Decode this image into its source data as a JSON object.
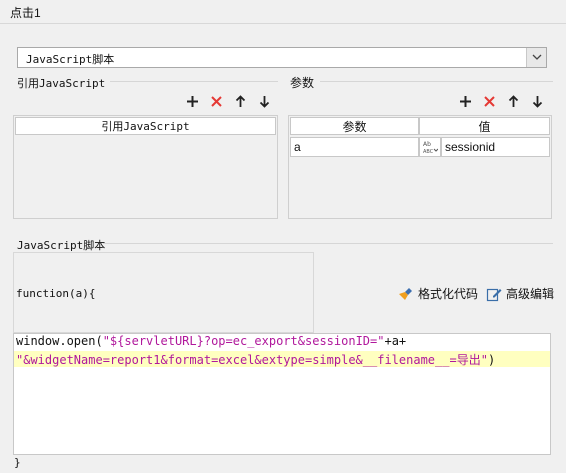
{
  "header": {
    "title": "点击1"
  },
  "script_type_select": {
    "value": "JavaScript脚本"
  },
  "ref_section": {
    "label": "引用JavaScript",
    "column_header": "引用JavaScript"
  },
  "param_section": {
    "label": "参数",
    "columns": [
      "参数",
      "值"
    ],
    "rows": [
      {
        "name": "a",
        "formula_icon_text": "公式",
        "value": "sessionid"
      }
    ]
  },
  "script_section": {
    "label": "JavaScript脚本",
    "function_signature": "function(a){",
    "format_code_label": "格式化代码",
    "advanced_edit_label": "高级编辑",
    "code": {
      "line1_prefix": "window.open(",
      "line1_string": "\"${servletURL}?op=ec_export&sessionID=\"",
      "line1_suffix": "+a+",
      "line2_string": "\"&widgetName=report1&format=excel&extype=simple&__filename__=导出\"",
      "line2_suffix": ")"
    },
    "closing_brace": "}"
  },
  "colors": {
    "add": "#222222",
    "delete": "#e53935",
    "string": "#b0189c",
    "highlight": "#ffffc0"
  }
}
